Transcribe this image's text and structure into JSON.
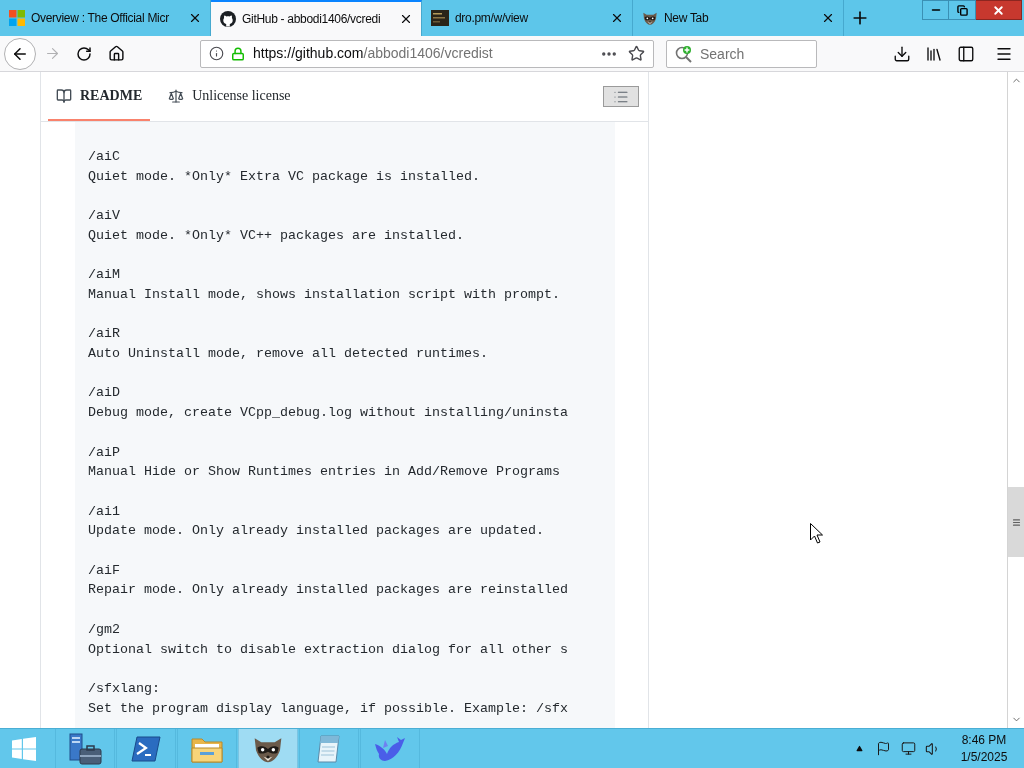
{
  "browser": {
    "tabs": [
      {
        "kind": "squares",
        "title": "Overview : The Official Micr",
        "selected": false
      },
      {
        "kind": "cat",
        "title": "GitHub - abbodi1406/vcredi",
        "selected": true
      },
      {
        "kind": "thumbnail",
        "title": "dro.pm/w/view",
        "selected": false
      },
      {
        "kind": "raccoon",
        "title": "New Tab",
        "selected": false
      }
    ],
    "address_bar": {
      "url": {
        "host": "https://github.com",
        "path": "/abbodi1406/vcredist"
      }
    },
    "search": {
      "placeholder": "Search"
    }
  },
  "readme": {
    "tabs": [
      {
        "kind": "book",
        "label": "README",
        "selected": true
      },
      {
        "kind": "scale",
        "label": "Unlicense license",
        "selected": false
      }
    ],
    "code_entries": [
      {
        "switch": "/aiC",
        "description": "Quiet mode. *Only* Extra VC package is installed."
      },
      {
        "switch": "/aiV",
        "description": "Quiet mode. *Only* VC++ packages are installed."
      },
      {
        "switch": "/aiM",
        "description": "Manual Install mode, shows installation script with prompt."
      },
      {
        "switch": "/aiR",
        "description": "Auto Uninstall mode, remove all detected runtimes."
      },
      {
        "switch": "/aiD",
        "description": "Debug mode, create VCpp_debug.log without installing/uninsta"
      },
      {
        "switch": "/aiP",
        "description": "Manual Hide or Show Runtimes entries in Add/Remove Programs"
      },
      {
        "switch": "/ai1",
        "description": "Update mode. Only already installed packages are updated."
      },
      {
        "switch": "/aiF",
        "description": "Repair mode. Only already installed packages are reinstalled"
      },
      {
        "switch": "/gm2",
        "description": "Optional switch to disable extraction dialog for all other s"
      },
      {
        "switch": "/sfxlang:",
        "description": "Set the program display language, if possible. Example: /sfx"
      }
    ]
  },
  "taskbar": {
    "apps": [
      {
        "kind": "server",
        "selected": false
      },
      {
        "kind": "terminal",
        "selected": false
      },
      {
        "kind": "folder",
        "selected": false
      },
      {
        "kind": "raccoon",
        "selected": true
      },
      {
        "kind": "notepad",
        "selected": false
      },
      {
        "kind": "bird",
        "selected": false
      }
    ],
    "clock": {
      "time": "8:46 PM",
      "date": "1/5/2025"
    }
  }
}
